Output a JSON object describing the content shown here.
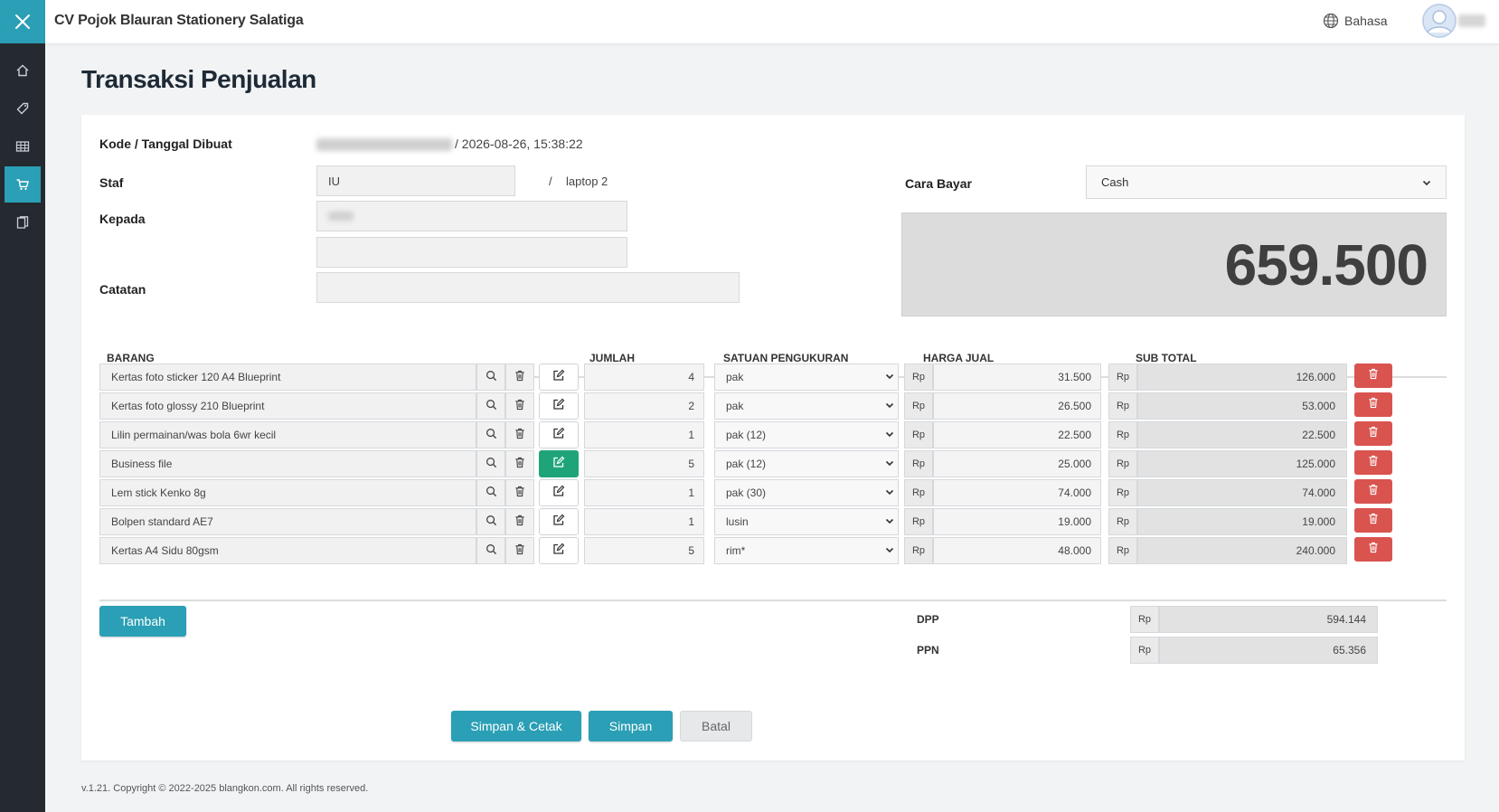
{
  "topbar": {
    "company": "CV Pojok Blauran Stationery Salatiga",
    "language_label": "Bahasa"
  },
  "sidebar": {
    "items": [
      {
        "icon": "home-icon"
      },
      {
        "icon": "tag-icon"
      },
      {
        "icon": "table-icon"
      },
      {
        "icon": "cart-icon",
        "active": true
      },
      {
        "icon": "book-icon"
      }
    ]
  },
  "page_title": "Transaksi Penjualan",
  "form": {
    "kode_label": "Kode / Tanggal Dibuat",
    "created_at": "/ 2026-08-26, 15:38:22",
    "staf_label": "Staf",
    "staf_value": "IU",
    "slash": "/",
    "device": "laptop 2",
    "kepada_label": "Kepada",
    "catatan_label": "Catatan",
    "catatan_value": "",
    "cara_bayar_label": "Cara Bayar",
    "cara_bayar_value": "Cash",
    "total": "659.500"
  },
  "table": {
    "headers": {
      "barang": "BARANG",
      "jumlah": "JUMLAH",
      "satuan": "SATUAN PENGUKURAN",
      "harga": "HARGA JUAL",
      "subtotal": "SUB TOTAL"
    },
    "currency": "Rp",
    "rows": [
      {
        "name": "Kertas foto sticker 120 A4 Blueprint",
        "qty": "4",
        "unit": "pak",
        "price": "31.500",
        "subtotal": "126.000",
        "edit_active": false
      },
      {
        "name": "Kertas foto glossy 210 Blueprint",
        "qty": "2",
        "unit": "pak",
        "price": "26.500",
        "subtotal": "53.000",
        "edit_active": false
      },
      {
        "name": "Lilin permainan/was bola 6wr kecil",
        "qty": "1",
        "unit": "pak (12)",
        "price": "22.500",
        "subtotal": "22.500",
        "edit_active": false
      },
      {
        "name": "Business file",
        "qty": "5",
        "unit": "pak (12)",
        "price": "25.000",
        "subtotal": "125.000",
        "edit_active": true
      },
      {
        "name": "Lem stick Kenko 8g",
        "qty": "1",
        "unit": "pak (30)",
        "price": "74.000",
        "subtotal": "74.000",
        "edit_active": false
      },
      {
        "name": "Bolpen standard AE7",
        "qty": "1",
        "unit": "lusin",
        "price": "19.000",
        "subtotal": "19.000",
        "edit_active": false
      },
      {
        "name": "Kertas A4 Sidu 80gsm",
        "qty": "5",
        "unit": "rim*",
        "price": "48.000",
        "subtotal": "240.000",
        "edit_active": false
      }
    ]
  },
  "summary": {
    "dpp_label": "DPP",
    "dpp_value": "594.144",
    "ppn_label": "PPN",
    "ppn_value": "65.356"
  },
  "buttons": {
    "tambah": "Tambah",
    "simpan_cetak": "Simpan & Cetak",
    "simpan": "Simpan",
    "batal": "Batal"
  },
  "footer": "v.1.21. Copyright © 2022-2025 blangkon.com. All rights reserved.",
  "colors": {
    "accent": "#2a9fb5",
    "sidebar": "#252a30",
    "danger": "#d9534f",
    "edit_active": "#1fa47a"
  }
}
